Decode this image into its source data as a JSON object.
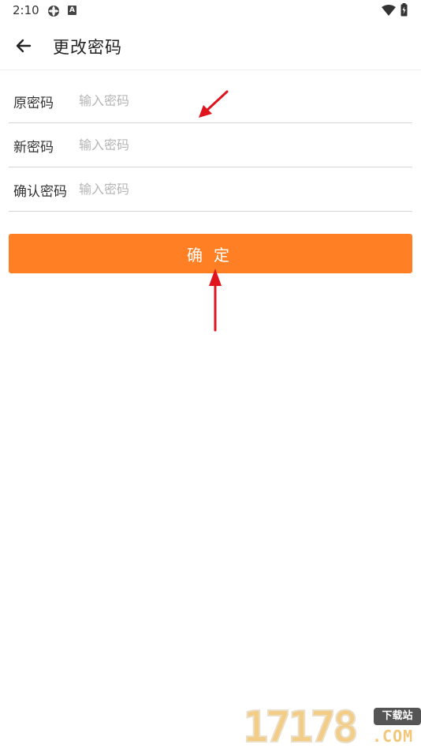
{
  "status_bar": {
    "time": "2:10",
    "icons": [
      "settings-icon",
      "a-notification-icon",
      "wifi-icon",
      "battery-charging-icon"
    ],
    "a_icon_text": "A"
  },
  "header": {
    "title": "更改密码",
    "back_icon": "arrow-left-icon"
  },
  "form": {
    "rows": [
      {
        "label": "原密码",
        "placeholder": "输入密码",
        "value": ""
      },
      {
        "label": "新密码",
        "placeholder": "输入密码",
        "value": ""
      },
      {
        "label": "确认密码",
        "placeholder": "输入密码",
        "value": ""
      }
    ]
  },
  "submit": {
    "label": "确定"
  },
  "colors": {
    "accent": "#ff8024",
    "annotation": "#e0141c",
    "divider": "#d6d6d6",
    "placeholder": "#b5b5b5"
  },
  "watermark": {
    "digits": "17178",
    "badge": "下载站",
    "suffix": ".COM"
  }
}
